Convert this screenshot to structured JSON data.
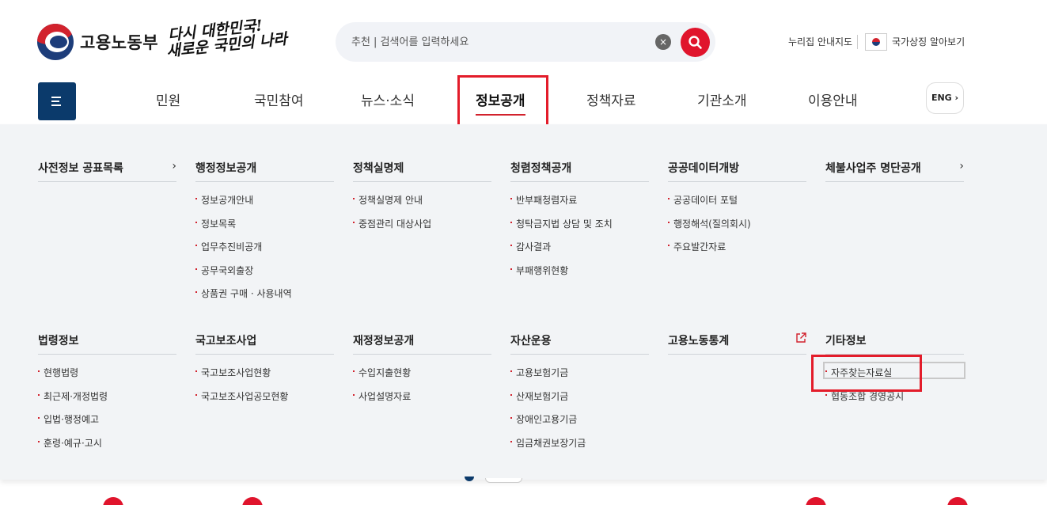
{
  "header": {
    "logo_text": "고용노동부",
    "slogan_line1": "다시 대한민국!",
    "slogan_line2": "새로운 국민의 나라",
    "search_placeholder": "추천 | 검색어를 입력하세요",
    "clear_label": "×",
    "util_map": "누리집 안내지도",
    "util_symbol": "국가상징 알아보기"
  },
  "gnb": {
    "items": [
      "민원",
      "국민참여",
      "뉴스·소식",
      "정보공개",
      "정책자료",
      "기관소개",
      "이용안내"
    ],
    "active": "정보공개",
    "eng_label": "ENG ›"
  },
  "mega_menu": {
    "row1": [
      {
        "title": "사전정보 공표목록",
        "arrow": "›",
        "items": []
      },
      {
        "title": "행정정보공개",
        "items": [
          "정보공개안내",
          "정보목록",
          "업무추진비공개",
          "공무국외출장",
          "상품권 구매 · 사용내역"
        ]
      },
      {
        "title": "정책실명제",
        "items": [
          "정책실명제 안내",
          "중점관리 대상사업"
        ]
      },
      {
        "title": "청렴정책공개",
        "items": [
          "반부패청렴자료",
          "청탁금지법 상담 및 조치",
          "감사결과",
          "부패행위현황"
        ]
      },
      {
        "title": "공공데이터개방",
        "items": [
          "공공데이터 포털",
          "행정해석(질의회시)",
          "주요발간자료"
        ]
      },
      {
        "title": "체불사업주 명단공개",
        "arrow": "›",
        "items": []
      }
    ],
    "row2": [
      {
        "title": "법령정보",
        "items": [
          "현행법령",
          "최근제·개정법령",
          "입법·행정예고",
          "훈령·예규·고시"
        ]
      },
      {
        "title": "국고보조사업",
        "items": [
          "국고보조사업현황",
          "국고보조사업공모현황"
        ]
      },
      {
        "title": "재정정보공개",
        "items": [
          "수입지출현황",
          "사업설명자료"
        ]
      },
      {
        "title": "자산운용",
        "items": [
          "고용보험기금",
          "산재보험기금",
          "장애인고용기금",
          "임금채권보장기금"
        ]
      },
      {
        "title": "고용노동통계",
        "external_icon": "external-link-icon",
        "items": []
      },
      {
        "title": "기타정보",
        "items": [
          "자주찾는자료실",
          "협동조합 경영공시"
        ]
      }
    ]
  },
  "colors": {
    "navy": "#0b3a6b",
    "red": "#e0142c",
    "highlight": "#e31c2a",
    "panel": "#f2f4f6"
  }
}
